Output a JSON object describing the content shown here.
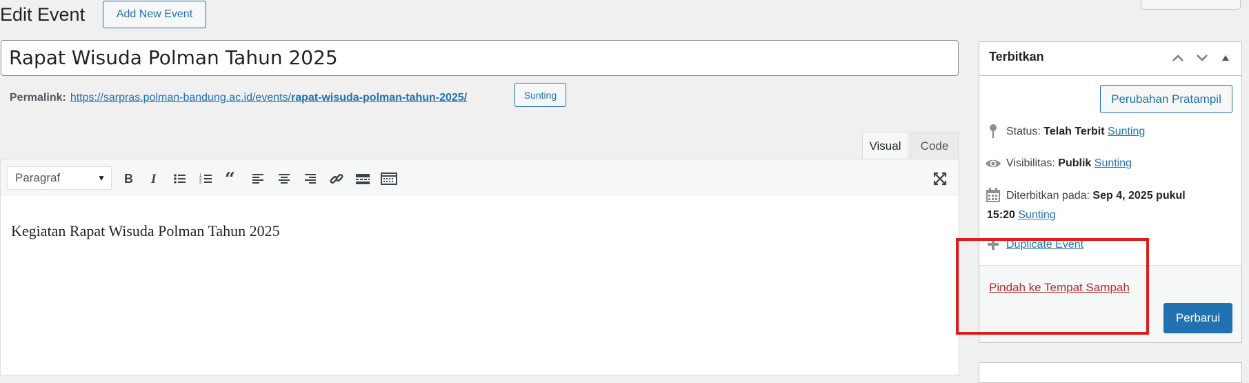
{
  "header": {
    "title": "Edit Event",
    "add_new_label": "Add New Event"
  },
  "post": {
    "title": "Rapat Wisuda Polman Tahun 2025",
    "permalink_label": "Permalink:",
    "permalink_base": "https://sarpras.polman-bandung.ac.id/events/",
    "permalink_slug": "rapat-wisuda-polman-tahun-2025/",
    "permalink_edit_label": "Sunting"
  },
  "editor": {
    "tabs": {
      "visual": "Visual",
      "code": "Code"
    },
    "format_select": "Paragraf",
    "toolbar_icons": [
      "bold-icon",
      "italic-icon",
      "bullet-list-icon",
      "numbered-list-icon",
      "blockquote-icon",
      "align-left-icon",
      "align-center-icon",
      "align-right-icon",
      "link-icon",
      "read-more-icon",
      "toolbar-toggle-icon",
      "fullscreen-icon"
    ],
    "content": "Kegiatan Rapat Wisuda Polman Tahun 2025"
  },
  "publish": {
    "title": "Terbitkan",
    "preview_label": "Perubahan Pratampil",
    "status_label": "Status:",
    "status_value": "Telah Terbit",
    "visibility_label": "Visibilitas:",
    "visibility_value": "Publik",
    "published_label": "Diterbitkan pada:",
    "published_value_line1": "Sep 4, 2025 pukul",
    "published_value_line2": "15:20",
    "edit_label": "Sunting",
    "duplicate_label": "Duplicate Event",
    "trash_label": "Pindah ke Tempat Sampah",
    "update_label": "Perbarui"
  },
  "colors": {
    "accent": "#2271b1",
    "trash": "#b32d2e",
    "highlight": "#e01b1b",
    "background": "#f0f0f1"
  }
}
